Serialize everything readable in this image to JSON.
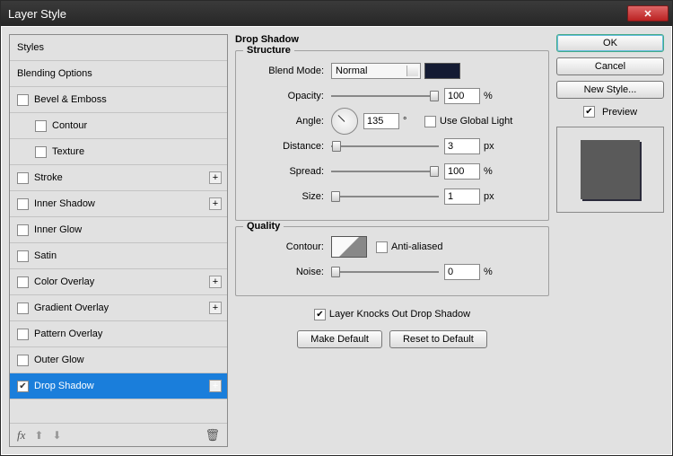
{
  "window": {
    "title": "Layer Style"
  },
  "left": {
    "styles_label": "Styles",
    "blending_label": "Blending Options",
    "items": [
      {
        "label": "Bevel & Emboss",
        "checked": false,
        "plus": false
      },
      {
        "label": "Contour",
        "checked": false,
        "indent": true
      },
      {
        "label": "Texture",
        "checked": false,
        "indent": true
      },
      {
        "label": "Stroke",
        "checked": false,
        "plus": true
      },
      {
        "label": "Inner Shadow",
        "checked": false,
        "plus": true
      },
      {
        "label": "Inner Glow",
        "checked": false
      },
      {
        "label": "Satin",
        "checked": false
      },
      {
        "label": "Color Overlay",
        "checked": false,
        "plus": true
      },
      {
        "label": "Gradient Overlay",
        "checked": false,
        "plus": true
      },
      {
        "label": "Pattern Overlay",
        "checked": false
      },
      {
        "label": "Outer Glow",
        "checked": false
      },
      {
        "label": "Drop Shadow",
        "checked": true,
        "plus": true,
        "selected": true
      }
    ],
    "fx_label": "fx"
  },
  "center": {
    "title": "Drop Shadow",
    "structure": {
      "legend": "Structure",
      "blend_mode_label": "Blend Mode:",
      "blend_mode_value": "Normal",
      "swatch_color": "#141b33",
      "opacity_label": "Opacity:",
      "opacity_value": "100",
      "opacity_unit": "%",
      "angle_label": "Angle:",
      "angle_value": "135",
      "angle_unit": "°",
      "global_light_label": "Use Global Light",
      "global_light_checked": false,
      "distance_label": "Distance:",
      "distance_value": "3",
      "distance_unit": "px",
      "spread_label": "Spread:",
      "spread_value": "100",
      "spread_unit": "%",
      "size_label": "Size:",
      "size_value": "1",
      "size_unit": "px"
    },
    "quality": {
      "legend": "Quality",
      "contour_label": "Contour:",
      "aa_label": "Anti-aliased",
      "aa_checked": false,
      "noise_label": "Noise:",
      "noise_value": "0",
      "noise_unit": "%"
    },
    "knockout_label": "Layer Knocks Out Drop Shadow",
    "knockout_checked": true,
    "make_default": "Make Default",
    "reset_default": "Reset to Default"
  },
  "right": {
    "ok": "OK",
    "cancel": "Cancel",
    "new_style": "New Style...",
    "preview_label": "Preview",
    "preview_checked": true
  }
}
